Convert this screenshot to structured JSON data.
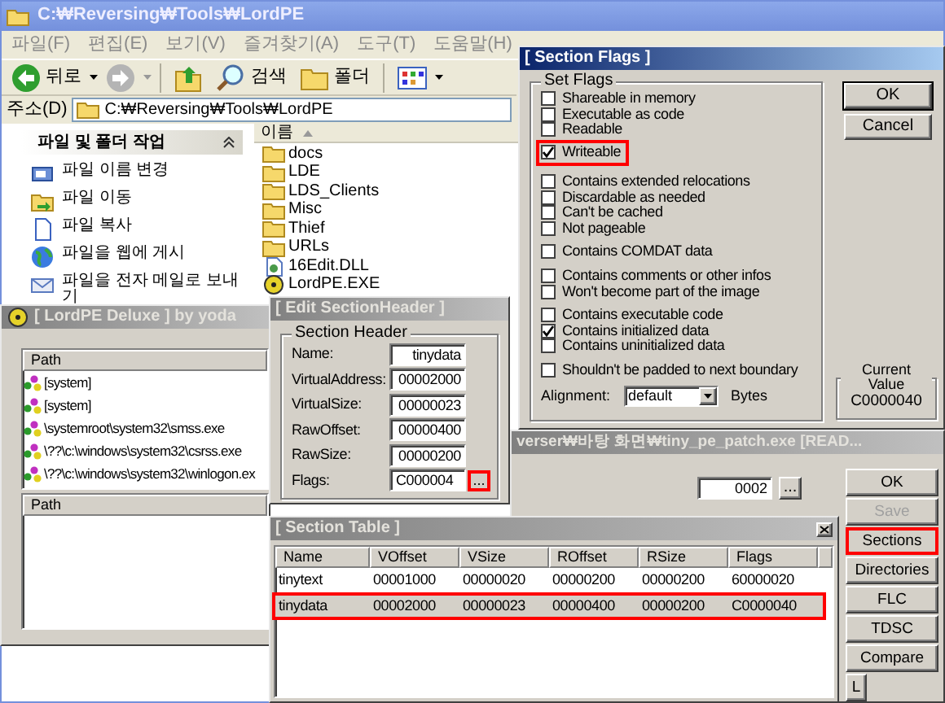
{
  "explorer": {
    "title": "C:₩Reversing₩Tools₩LordPE",
    "active": false,
    "menu": [
      "파일(F)",
      "편집(E)",
      "보기(V)",
      "즐겨찾기(A)",
      "도구(T)",
      "도움말(H)"
    ],
    "toolbar": [
      {
        "kind": "back",
        "label": "뒤로"
      },
      {
        "kind": "forward"
      },
      {
        "kind": "up"
      },
      {
        "kind": "search",
        "label": "검색"
      },
      {
        "kind": "folders",
        "label": "폴더"
      },
      {
        "kind": "views"
      }
    ],
    "address_label": "주소(D)",
    "address": "C:₩Reversing₩Tools₩LordPE",
    "tasks": {
      "title": "파일 및 폴더 작업",
      "items": [
        {
          "kind": "rename",
          "label": "파일 이름 변경"
        },
        {
          "kind": "move",
          "label": "파일 이동"
        },
        {
          "kind": "copy",
          "label": "파일 복사"
        },
        {
          "kind": "publish",
          "label": "파일을 웹에 게시"
        },
        {
          "kind": "email",
          "label": "파일을 전자 메일로 보내기"
        }
      ]
    },
    "files": {
      "column": "이름",
      "items": [
        {
          "kind": "folder",
          "name": "docs"
        },
        {
          "kind": "folder",
          "name": "LDE"
        },
        {
          "kind": "folder",
          "name": "LDS_Clients"
        },
        {
          "kind": "folder",
          "name": "Misc"
        },
        {
          "kind": "folder",
          "name": "Thief"
        },
        {
          "kind": "folder",
          "name": "URLs"
        },
        {
          "kind": "dll",
          "name": "16Edit.DLL"
        },
        {
          "kind": "exe",
          "name": "LordPE.EXE"
        }
      ]
    }
  },
  "lordpe": {
    "title": "[ LordPE Deluxe ] by yoda",
    "active": false,
    "process_column": "Path",
    "processes": [
      {
        "kind": "system",
        "path": "[system]"
      },
      {
        "kind": "system",
        "path": "[system]"
      },
      {
        "kind": "system",
        "path": "\\systemroot\\system32\\smss.exe"
      },
      {
        "kind": "system",
        "path": "\\??\\c:\\windows\\system32\\csrss.exe"
      },
      {
        "kind": "system",
        "path": "\\??\\c:\\windows\\system32\\winlogon.ex"
      }
    ],
    "module_column": "Path"
  },
  "edit_section_header": {
    "title": "[ Edit SectionHeader ]",
    "active": false,
    "group": "Section Header",
    "fields": [
      {
        "label": "Name:",
        "value": "tinydata"
      },
      {
        "label": "VirtualAddress:",
        "value": "00002000"
      },
      {
        "label": "VirtualSize:",
        "value": "00000023"
      },
      {
        "label": "RawOffset:",
        "value": "00000400"
      },
      {
        "label": "RawSize:",
        "value": "00000200"
      },
      {
        "label": "Flags:",
        "value": "C000004"
      }
    ],
    "flags_button": {
      "label": "...",
      "highlighted": true
    }
  },
  "pe_editor": {
    "title": "verser₩바탕 화면₩tiny_pe_patch.exe [READ...",
    "active": false,
    "field": {
      "value": "0002",
      "button": "..."
    },
    "buttons": [
      {
        "label": "OK",
        "disabled": false,
        "highlighted": false
      },
      {
        "label": "Save",
        "disabled": true,
        "highlighted": false
      },
      {
        "label": "Sections",
        "disabled": false,
        "highlighted": true
      },
      {
        "label": "Directories",
        "disabled": false,
        "highlighted": false
      },
      {
        "label": "FLC",
        "disabled": false,
        "highlighted": false
      },
      {
        "label": "TDSC",
        "disabled": false,
        "highlighted": false
      },
      {
        "label": "Compare",
        "disabled": false,
        "highlighted": false
      },
      {
        "label": "L",
        "disabled": false,
        "highlighted": false
      }
    ]
  },
  "section_table": {
    "title": "[ Section Table ]",
    "active": false,
    "columns": [
      "Name",
      "VOffset",
      "VSize",
      "ROffset",
      "RSize",
      "Flags"
    ],
    "rows": [
      {
        "cells": [
          "tinytext",
          "00001000",
          "00000020",
          "00000200",
          "00000200",
          "60000020"
        ],
        "selected": false,
        "highlighted": false
      },
      {
        "cells": [
          "tinydata",
          "00002000",
          "00000023",
          "00000400",
          "00000200",
          "C0000040"
        ],
        "selected": true,
        "highlighted": true
      }
    ]
  },
  "section_flags": {
    "title": "[ Section Flags ]",
    "active": true,
    "group": "Set Flags",
    "flag_groups": [
      [
        {
          "label": "Shareable in memory",
          "checked": false,
          "highlighted": false
        },
        {
          "label": "Executable as code",
          "checked": false,
          "highlighted": false
        },
        {
          "label": "Readable",
          "checked": false,
          "highlighted": false
        },
        {
          "label": "Writeable",
          "checked": true,
          "highlighted": true
        }
      ],
      [
        {
          "label": "Contains extended relocations",
          "checked": false,
          "highlighted": false
        },
        {
          "label": "Discardable as needed",
          "checked": false,
          "highlighted": false
        },
        {
          "label": "Can't be cached",
          "checked": false,
          "highlighted": false
        },
        {
          "label": "Not pageable",
          "checked": false,
          "highlighted": false
        }
      ],
      [
        {
          "label": "Contains COMDAT data",
          "checked": false,
          "highlighted": false
        }
      ],
      [
        {
          "label": "Contains comments or other infos",
          "checked": false,
          "highlighted": false
        },
        {
          "label": "Won't become part of the image",
          "checked": false,
          "highlighted": false
        }
      ],
      [
        {
          "label": "Contains executable code",
          "checked": false,
          "highlighted": false
        },
        {
          "label": "Contains initialized data",
          "checked": true,
          "highlighted": false
        },
        {
          "label": "Contains uninitialized data",
          "checked": false,
          "highlighted": false
        }
      ],
      [
        {
          "label": "Shouldn't be padded to next boundary",
          "checked": false,
          "highlighted": false
        }
      ]
    ],
    "alignment_label": "Alignment:",
    "alignment": "default",
    "alignment_unit": "Bytes",
    "buttons": [
      {
        "label": "OK",
        "default": true
      },
      {
        "label": "Cancel",
        "default": false
      }
    ],
    "current_value": {
      "label": "Current Value",
      "value": "C0000040"
    }
  }
}
